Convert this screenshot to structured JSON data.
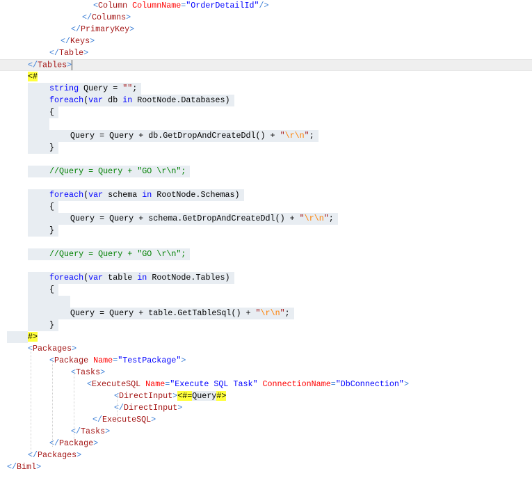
{
  "editor": {
    "current_line": 6,
    "lines": [
      [
        [
          "b",
          "<"
        ],
        [
          "e",
          "Column "
        ],
        [
          "a",
          "ColumnName"
        ],
        [
          "b",
          "="
        ],
        [
          "v",
          "\"OrderDetailId\""
        ],
        [
          "b",
          "/>"
        ]
      ],
      [
        [
          "b",
          "</"
        ],
        [
          "e",
          "Columns"
        ],
        [
          "b",
          ">"
        ]
      ],
      [
        [
          "b",
          "</"
        ],
        [
          "e",
          "PrimaryKey"
        ],
        [
          "b",
          ">"
        ]
      ],
      [
        [
          "b",
          "</"
        ],
        [
          "e",
          "Keys"
        ],
        [
          "b",
          ">"
        ]
      ],
      [
        [
          "b",
          "</"
        ],
        [
          "e",
          "Table"
        ],
        [
          "b",
          ">"
        ]
      ],
      [
        [
          "b",
          "</"
        ],
        [
          "e",
          "Tables"
        ],
        [
          "b",
          ">"
        ]
      ],
      [
        [
          "y",
          "<#"
        ]
      ],
      [
        [
          "k",
          "string"
        ],
        [
          "p",
          " Query = "
        ],
        [
          "s",
          "\"\""
        ],
        [
          "p",
          ";"
        ]
      ],
      [
        [
          "k",
          "foreach"
        ],
        [
          "p",
          "("
        ],
        [
          "k",
          "var"
        ],
        [
          "p",
          " db "
        ],
        [
          "k",
          "in"
        ],
        [
          "p",
          " RootNode.Databases)"
        ]
      ],
      [
        [
          "p",
          "{"
        ]
      ],
      [],
      [
        [
          "p",
          "Query = Query + db.GetDropAndCreateDdl() + "
        ],
        [
          "s",
          "\""
        ],
        [
          "x",
          "\\r\\n"
        ],
        [
          "s",
          "\""
        ],
        [
          "p",
          ";"
        ]
      ],
      [
        [
          "p",
          "}"
        ]
      ],
      [],
      [
        [
          "c",
          "//Query = Query + \"GO \\r\\n\";"
        ]
      ],
      [],
      [
        [
          "k",
          "foreach"
        ],
        [
          "p",
          "("
        ],
        [
          "k",
          "var"
        ],
        [
          "p",
          " schema "
        ],
        [
          "k",
          "in"
        ],
        [
          "p",
          " RootNode.Schemas)"
        ]
      ],
      [
        [
          "p",
          "{"
        ]
      ],
      [
        [
          "p",
          "Query = Query + schema.GetDropAndCreateDdl() + "
        ],
        [
          "s",
          "\""
        ],
        [
          "x",
          "\\r\\n"
        ],
        [
          "s",
          "\""
        ],
        [
          "p",
          ";"
        ]
      ],
      [
        [
          "p",
          "}"
        ]
      ],
      [],
      [
        [
          "c",
          "//Query = Query + \"GO \\r\\n\";"
        ]
      ],
      [],
      [
        [
          "k",
          "foreach"
        ],
        [
          "p",
          "("
        ],
        [
          "k",
          "var"
        ],
        [
          "p",
          " table "
        ],
        [
          "k",
          "in"
        ],
        [
          "p",
          " RootNode.Tables)"
        ]
      ],
      [
        [
          "p",
          "{"
        ]
      ],
      [],
      [
        [
          "p",
          "Query = Query + table.GetTableSql() + "
        ],
        [
          "s",
          "\""
        ],
        [
          "x",
          "\\r\\n"
        ],
        [
          "s",
          "\""
        ],
        [
          "p",
          ";"
        ]
      ],
      [
        [
          "p",
          "}"
        ]
      ],
      [
        [
          "y",
          "#>"
        ]
      ],
      [
        [
          "b",
          "<"
        ],
        [
          "e",
          "Packages"
        ],
        [
          "b",
          ">"
        ]
      ],
      [
        [
          "b",
          "<"
        ],
        [
          "e",
          "Package "
        ],
        [
          "a",
          "Name"
        ],
        [
          "b",
          "="
        ],
        [
          "v",
          "\"TestPackage\""
        ],
        [
          "b",
          ">"
        ]
      ],
      [
        [
          "b",
          "<"
        ],
        [
          "e",
          "Tasks"
        ],
        [
          "b",
          ">"
        ]
      ],
      [
        [
          "b",
          "<"
        ],
        [
          "e",
          "ExecuteSQL "
        ],
        [
          "a",
          "Name"
        ],
        [
          "b",
          "="
        ],
        [
          "v",
          "\"Execute SQL Task\""
        ],
        [
          "e",
          " "
        ],
        [
          "a",
          "ConnectionName"
        ],
        [
          "b",
          "="
        ],
        [
          "v",
          "\"DbConnection\""
        ],
        [
          "b",
          ">"
        ]
      ],
      [
        [
          "b",
          "<"
        ],
        [
          "e",
          "DirectInput"
        ],
        [
          "b",
          ">"
        ],
        [
          "y",
          "<#="
        ],
        [
          "q",
          "Query"
        ],
        [
          "y",
          "#>"
        ]
      ],
      [
        [
          "b",
          "</"
        ],
        [
          "e",
          "DirectInput"
        ],
        [
          "b",
          ">"
        ]
      ],
      [
        [
          "b",
          "</"
        ],
        [
          "e",
          "ExecuteSQL"
        ],
        [
          "b",
          ">"
        ]
      ],
      [
        [
          "b",
          "</"
        ],
        [
          "e",
          "Tasks"
        ],
        [
          "b",
          ">"
        ]
      ],
      [
        [
          "b",
          "</"
        ],
        [
          "e",
          "Package"
        ],
        [
          "b",
          ">"
        ]
      ],
      [
        [
          "b",
          "</"
        ],
        [
          "e",
          "Packages"
        ],
        [
          "b",
          ">"
        ]
      ],
      [
        [
          "b",
          "</"
        ],
        [
          "e",
          "Biml"
        ],
        [
          "b",
          ">"
        ]
      ]
    ]
  }
}
